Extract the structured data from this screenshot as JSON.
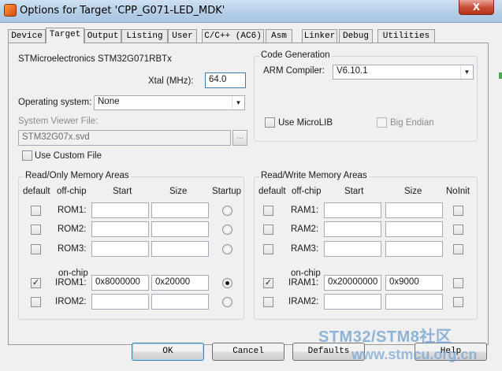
{
  "window": {
    "title": "Options for Target 'CPP_G071-LED_MDK'",
    "close_label": "X"
  },
  "tabs": [
    {
      "label": "Device",
      "active": false
    },
    {
      "label": "Target",
      "active": true
    },
    {
      "label": "Output",
      "active": false
    },
    {
      "label": "Listing",
      "active": false
    },
    {
      "label": "User",
      "active": false
    },
    {
      "label": "C/C++ (AC6)",
      "active": false
    },
    {
      "label": "Asm",
      "active": false
    },
    {
      "label": "Linker",
      "active": false
    },
    {
      "label": "Debug",
      "active": false
    },
    {
      "label": "Utilities",
      "active": false
    }
  ],
  "target": {
    "device_name": "STMicroelectronics STM32G071RBTx",
    "xtal_label": "Xtal (MHz):",
    "xtal_value": "64.0",
    "os_label": "Operating system:",
    "os_value": "None",
    "svd_label": "System Viewer File:",
    "svd_value": "STM32G07x.svd",
    "svd_browse": "...",
    "custom_file_label": "Use Custom File",
    "custom_file_checked": false
  },
  "codegen": {
    "title": "Code Generation",
    "compiler_label": "ARM Compiler:",
    "compiler_value": "V6.10.1",
    "microlib_label": "Use MicroLIB",
    "microlib_checked": false,
    "big_endian_label": "Big Endian",
    "big_endian_checked": false
  },
  "rom": {
    "title": "Read/Only Memory Areas",
    "headers": {
      "default": "default",
      "offchip": "off-chip",
      "start": "Start",
      "size": "Size",
      "startup": "Startup"
    },
    "onchip_label": "on-chip",
    "rows": [
      {
        "name": "ROM1:",
        "default": false,
        "start": "",
        "size": "",
        "startup": false
      },
      {
        "name": "ROM2:",
        "default": false,
        "start": "",
        "size": "",
        "startup": false
      },
      {
        "name": "ROM3:",
        "default": false,
        "start": "",
        "size": "",
        "startup": false
      },
      {
        "name": "IROM1:",
        "default": true,
        "start": "0x8000000",
        "size": "0x20000",
        "startup": true
      },
      {
        "name": "IROM2:",
        "default": false,
        "start": "",
        "size": "",
        "startup": false
      }
    ]
  },
  "ram": {
    "title": "Read/Write Memory Areas",
    "headers": {
      "default": "default",
      "offchip": "off-chip",
      "start": "Start",
      "size": "Size",
      "noinit": "NoInit"
    },
    "onchip_label": "on-chip",
    "rows": [
      {
        "name": "RAM1:",
        "default": false,
        "start": "",
        "size": "",
        "noinit": false
      },
      {
        "name": "RAM2:",
        "default": false,
        "start": "",
        "size": "",
        "noinit": false
      },
      {
        "name": "RAM3:",
        "default": false,
        "start": "",
        "size": "",
        "noinit": false
      },
      {
        "name": "IRAM1:",
        "default": true,
        "start": "0x20000000",
        "size": "0x9000",
        "noinit": false
      },
      {
        "name": "IRAM2:",
        "default": false,
        "start": "",
        "size": "",
        "noinit": false
      }
    ]
  },
  "buttons": {
    "ok": "OK",
    "cancel": "Cancel",
    "defaults": "Defaults",
    "help": "Help"
  },
  "watermark": {
    "text": "STM32/STM8社区",
    "url": "www.stmcu.org.cn"
  }
}
